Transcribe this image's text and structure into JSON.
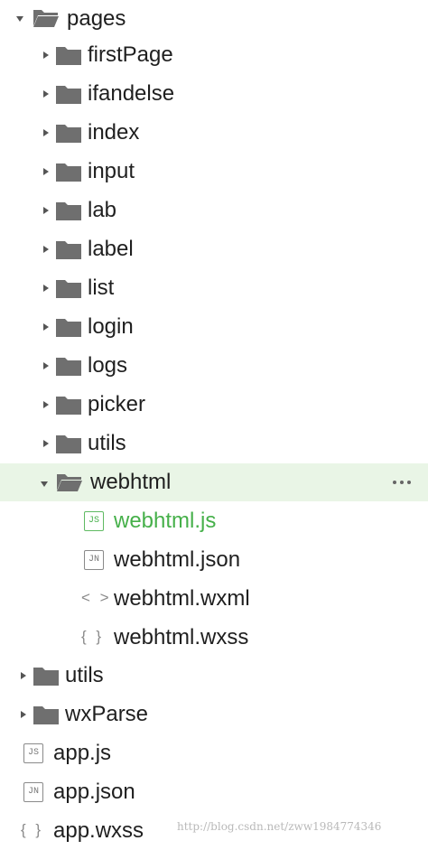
{
  "tree": {
    "root_folder": "pages",
    "subfolders": [
      "firstPage",
      "ifandelse",
      "index",
      "input",
      "lab",
      "label",
      "list",
      "login",
      "logs",
      "picker",
      "utils"
    ],
    "open_folder": "webhtml",
    "open_folder_files": [
      {
        "name": "webhtml.js",
        "icon": "js-file-icon",
        "badge": "JS"
      },
      {
        "name": "webhtml.json",
        "icon": "json-file-icon",
        "badge": "JN"
      },
      {
        "name": "webhtml.wxml",
        "icon": "wxml-file-icon",
        "badge": "< >"
      },
      {
        "name": "webhtml.wxss",
        "icon": "wxss-file-icon",
        "badge": "{ }"
      }
    ],
    "top_folders": [
      "utils",
      "wxParse"
    ],
    "root_files": [
      {
        "name": "app.js",
        "icon": "js-file-icon",
        "badge": "JS"
      },
      {
        "name": "app.json",
        "icon": "json-file-icon",
        "badge": "JN"
      },
      {
        "name": "app.wxss",
        "icon": "wxss-file-icon",
        "badge": "{ }"
      }
    ]
  },
  "colors": {
    "selected_bg": "#e9f5e6",
    "active_text": "#46b04a",
    "folder": "#6f6f6f"
  },
  "watermark": "http://blog.csdn.net/zww1984774346"
}
